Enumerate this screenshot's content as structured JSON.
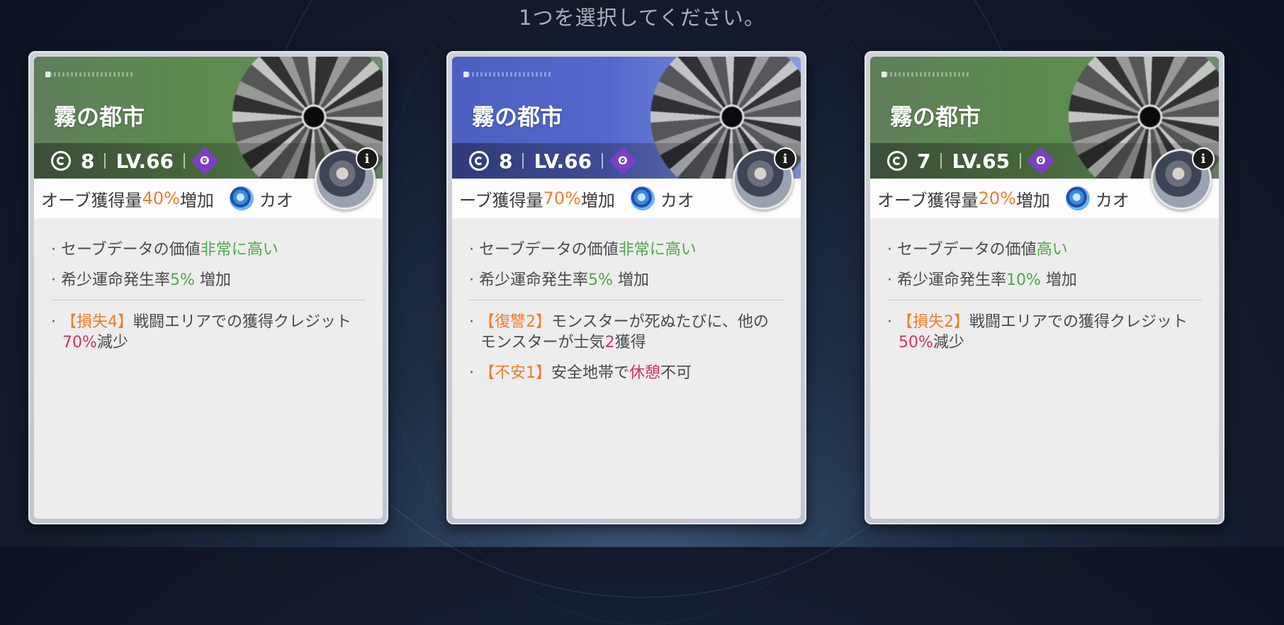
{
  "prompt": "1つを選択してください。",
  "cards": [
    {
      "title": "霧の都市",
      "level_count": "8",
      "level": "LV.66",
      "orb_prefix": "オーブ獲得量",
      "orb_value": "40%",
      "orb_suffix": "増加",
      "companion": "カオ",
      "save_prefix": "セーブデータの価値",
      "save_value": "非常に高い",
      "rare_prefix": "希少運命発生率",
      "rare_value": "5%",
      "rare_suffix": " 増加",
      "debuffs": [
        {
          "tag": "【損失4】",
          "pre": "戦闘エリアでの獲得クレジット",
          "hl": "70%",
          "post": "減少"
        }
      ]
    },
    {
      "title": "霧の都市",
      "level_count": "8",
      "level": "LV.66",
      "orb_prefix": "ーブ獲得量",
      "orb_value": "70%",
      "orb_suffix": "増加",
      "companion": "カオ",
      "save_prefix": "セーブデータの価値",
      "save_value": "非常に高い",
      "rare_prefix": "希少運命発生率",
      "rare_value": "5%",
      "rare_suffix": " 増加",
      "debuffs": [
        {
          "tag": "【復讐2】",
          "pre": "モンスターが死ぬたびに、他のモンスターが士気",
          "hl": "2",
          "post": "獲得"
        },
        {
          "tag": "【不安1】",
          "pre": "安全地帯で",
          "hl": "休憩",
          "post": "不可"
        }
      ]
    },
    {
      "title": "霧の都市",
      "level_count": "7",
      "level": "LV.65",
      "orb_prefix": "オーブ獲得量",
      "orb_value": "20%",
      "orb_suffix": "増加",
      "companion": "カオ",
      "save_prefix": "セーブデータの価値",
      "save_value": "高い",
      "rare_prefix": "希少運命発生率",
      "rare_value": "10%",
      "rare_suffix": " 増加",
      "debuffs": [
        {
          "tag": "【損失2】",
          "pre": "戦闘エリアでの獲得クレジット",
          "hl": "50%",
          "post": "減少"
        }
      ]
    }
  ],
  "info_label": "i",
  "colors": {
    "orange": "#ef7d2e",
    "green": "#4fa84a",
    "red": "#d2355f",
    "banner_green": "#5c8a4e",
    "banner_blue": "#5468cc"
  }
}
